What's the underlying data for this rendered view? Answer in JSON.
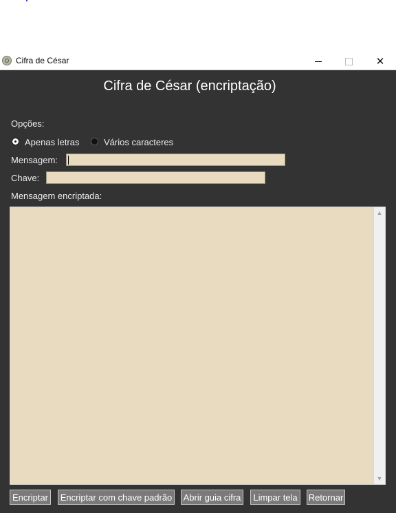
{
  "window": {
    "title": "Cifra de César",
    "controls": {
      "minimize": "minimize-icon",
      "maximize": "maximize-icon",
      "close": "close-icon"
    }
  },
  "main": {
    "heading": "Cifra de César (encriptação)",
    "options_label": "Opções:",
    "radio_options": [
      {
        "label": "Apenas letras",
        "selected": true
      },
      {
        "label": "Vários caracteres",
        "selected": false
      }
    ],
    "message_label": "Mensagem:",
    "message_value": "",
    "key_label": "Chave:",
    "key_value": "",
    "output_label": "Mensagem encriptada:",
    "output_value": ""
  },
  "buttons": [
    {
      "label": "Encriptar"
    },
    {
      "label": "Encriptar com chave padrão"
    },
    {
      "label": "Abrir guia cifra"
    },
    {
      "label": "Limpar tela"
    },
    {
      "label": "Retornar"
    }
  ],
  "colors": {
    "window_bg": "#333333",
    "field_bg": "#e8dbc0",
    "button_bg": "#7a7a7a",
    "text": "#ececec"
  }
}
